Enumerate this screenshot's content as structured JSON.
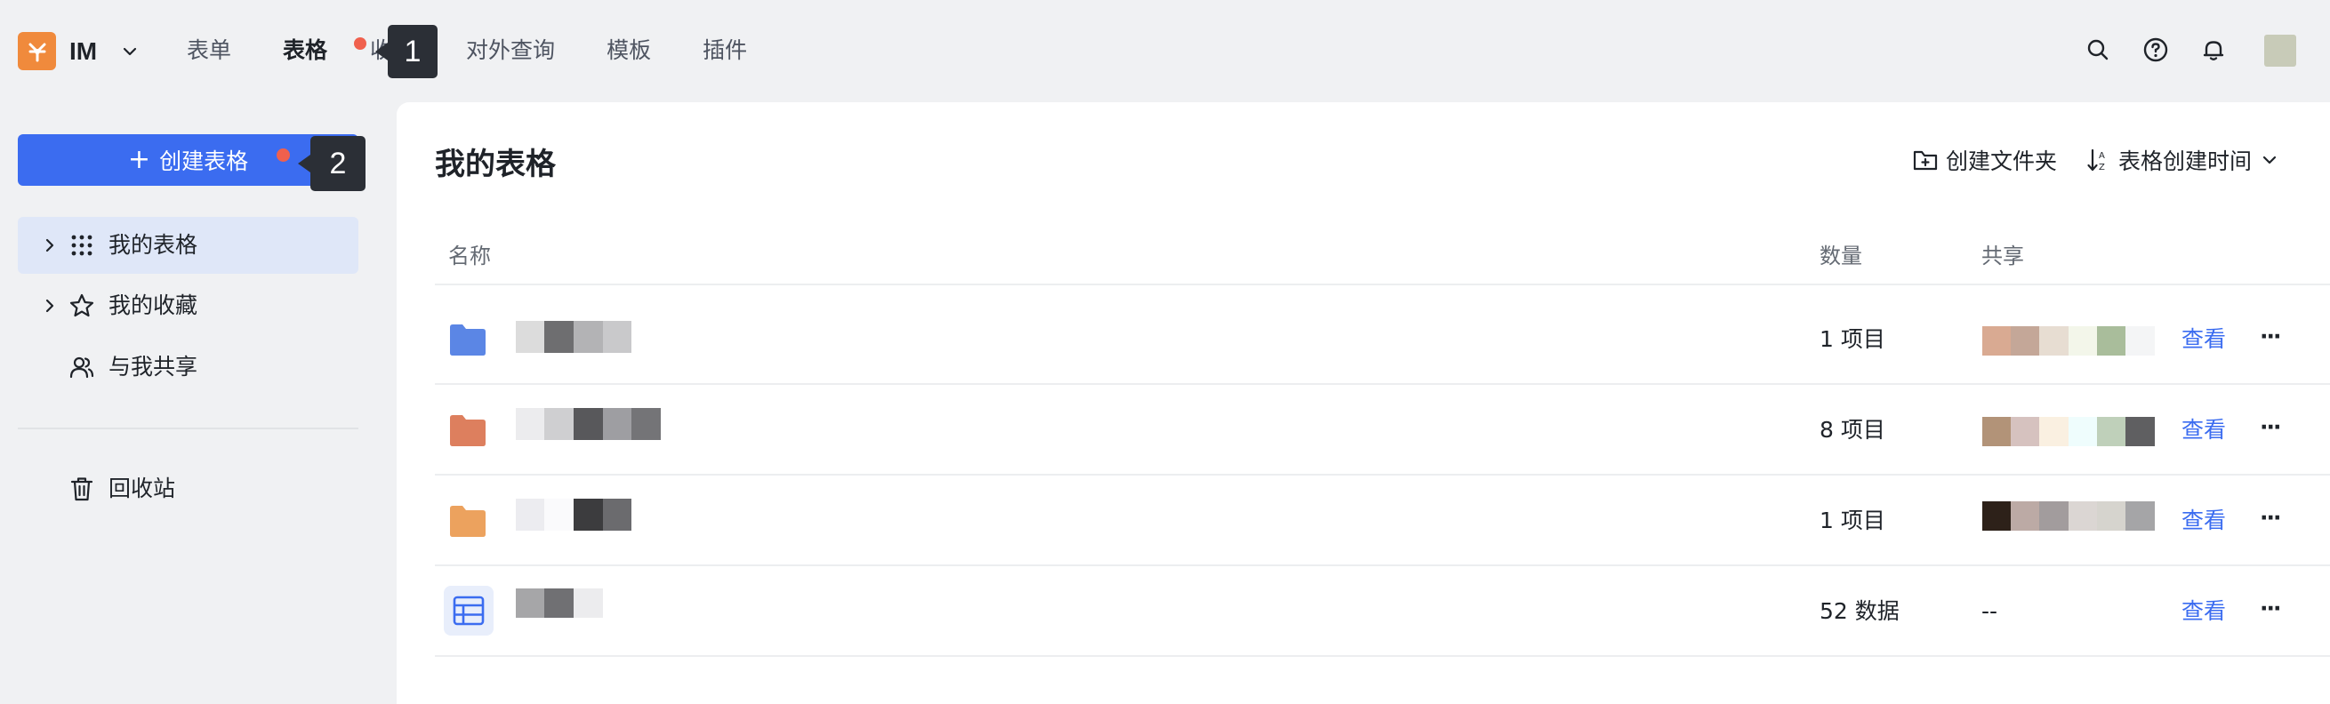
{
  "app": {
    "name": "IM"
  },
  "nav": {
    "items": [
      {
        "label": "表单"
      },
      {
        "label": "表格"
      },
      {
        "label": "收款"
      },
      {
        "label": "对外查询"
      },
      {
        "label": "模板"
      },
      {
        "label": "插件"
      }
    ],
    "active_index": 1
  },
  "markers": {
    "m1": "1",
    "m2": "2"
  },
  "sidebar": {
    "create_button": "创建表格",
    "items": [
      {
        "label": "我的表格"
      },
      {
        "label": "我的收藏"
      },
      {
        "label": "与我共享"
      },
      {
        "label": "回收站"
      }
    ]
  },
  "main": {
    "title": "我的表格",
    "actions": {
      "new_folder": "创建文件夹",
      "sort": "表格创建时间"
    },
    "columns": {
      "name": "名称",
      "count": "数量",
      "share": "共享"
    },
    "rows": [
      {
        "type": "folder",
        "color": "#5b86e5",
        "count": "1 项目",
        "share": "",
        "view": "查看"
      },
      {
        "type": "folder",
        "color": "#dd7f5e",
        "count": "8 项目",
        "share": "",
        "view": "查看"
      },
      {
        "type": "folder",
        "color": "#eca25e",
        "count": "1 项目",
        "share": "",
        "view": "查看"
      },
      {
        "type": "table",
        "color": "#3b6cf0",
        "count": "52 数据",
        "share": "--",
        "view": "查看"
      }
    ]
  },
  "colors": {
    "accent": "#3b6cf0",
    "badge": "#f0604d",
    "logo": "#f08a3c"
  }
}
